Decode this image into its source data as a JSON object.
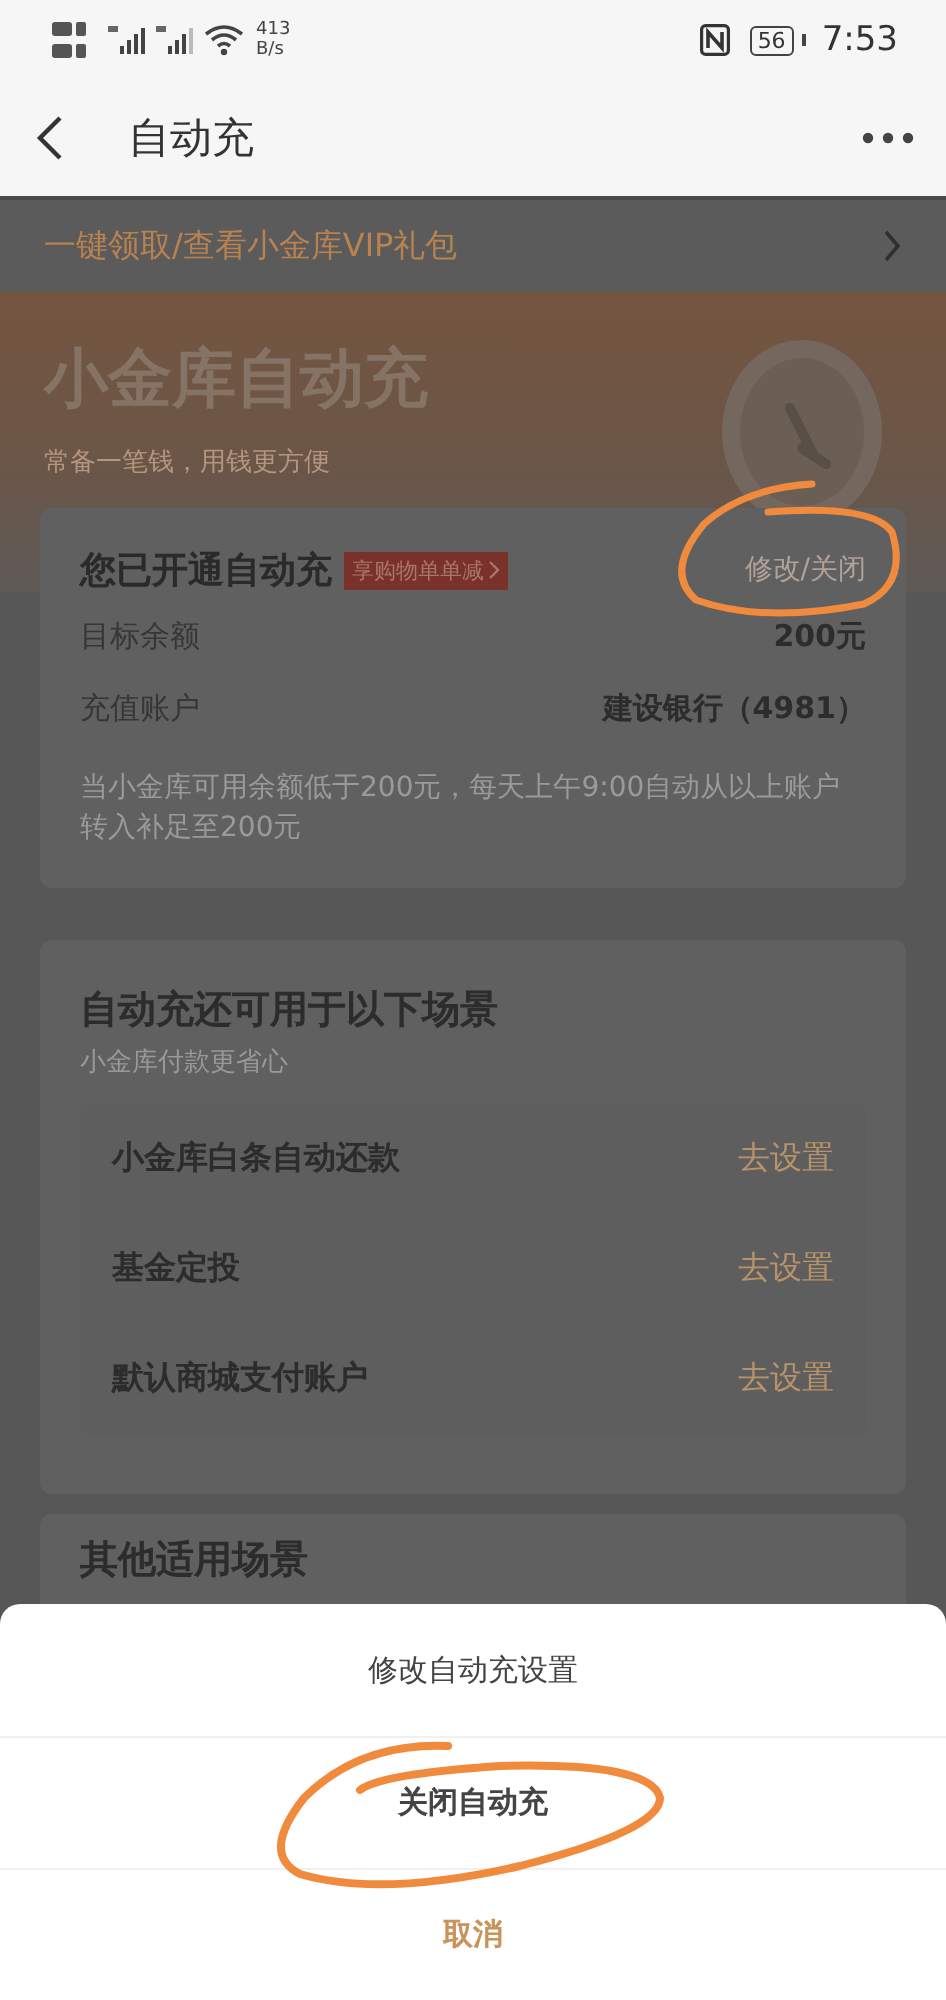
{
  "status_bar": {
    "net_speed_value": "413",
    "net_speed_unit": "B/s",
    "battery": "56",
    "time": "7:53"
  },
  "nav": {
    "title": "自动充"
  },
  "promo_bar": {
    "text": "一键领取/查看小金库VIP礼包"
  },
  "hero": {
    "title": "小金库自动充",
    "subtitle": "常备一笔钱，用钱更方便"
  },
  "status_card": {
    "title": "您已开通自动充",
    "tag": "享购物单单减",
    "action": "修改/关闭",
    "rows": [
      {
        "label": "目标余额",
        "value": "200元"
      },
      {
        "label": "充值账户",
        "value": "建设银行（4981）"
      }
    ],
    "note": "当小金库可用余额低于200元，每天上午9:00自动从以上账户转入补足至200元"
  },
  "scenes": {
    "title": "自动充还可用于以下场景",
    "subtitle": "小金库付款更省心",
    "items": [
      {
        "label": "小金库白条自动还款",
        "action": "去设置"
      },
      {
        "label": "基金定投",
        "action": "去设置"
      },
      {
        "label": "默认商城支付账户",
        "action": "去设置"
      }
    ]
  },
  "other_scenes": {
    "title": "其他适用场景"
  },
  "sheet": {
    "title": "修改自动充设置",
    "options": [
      "关闭自动充"
    ],
    "cancel": "取消"
  }
}
